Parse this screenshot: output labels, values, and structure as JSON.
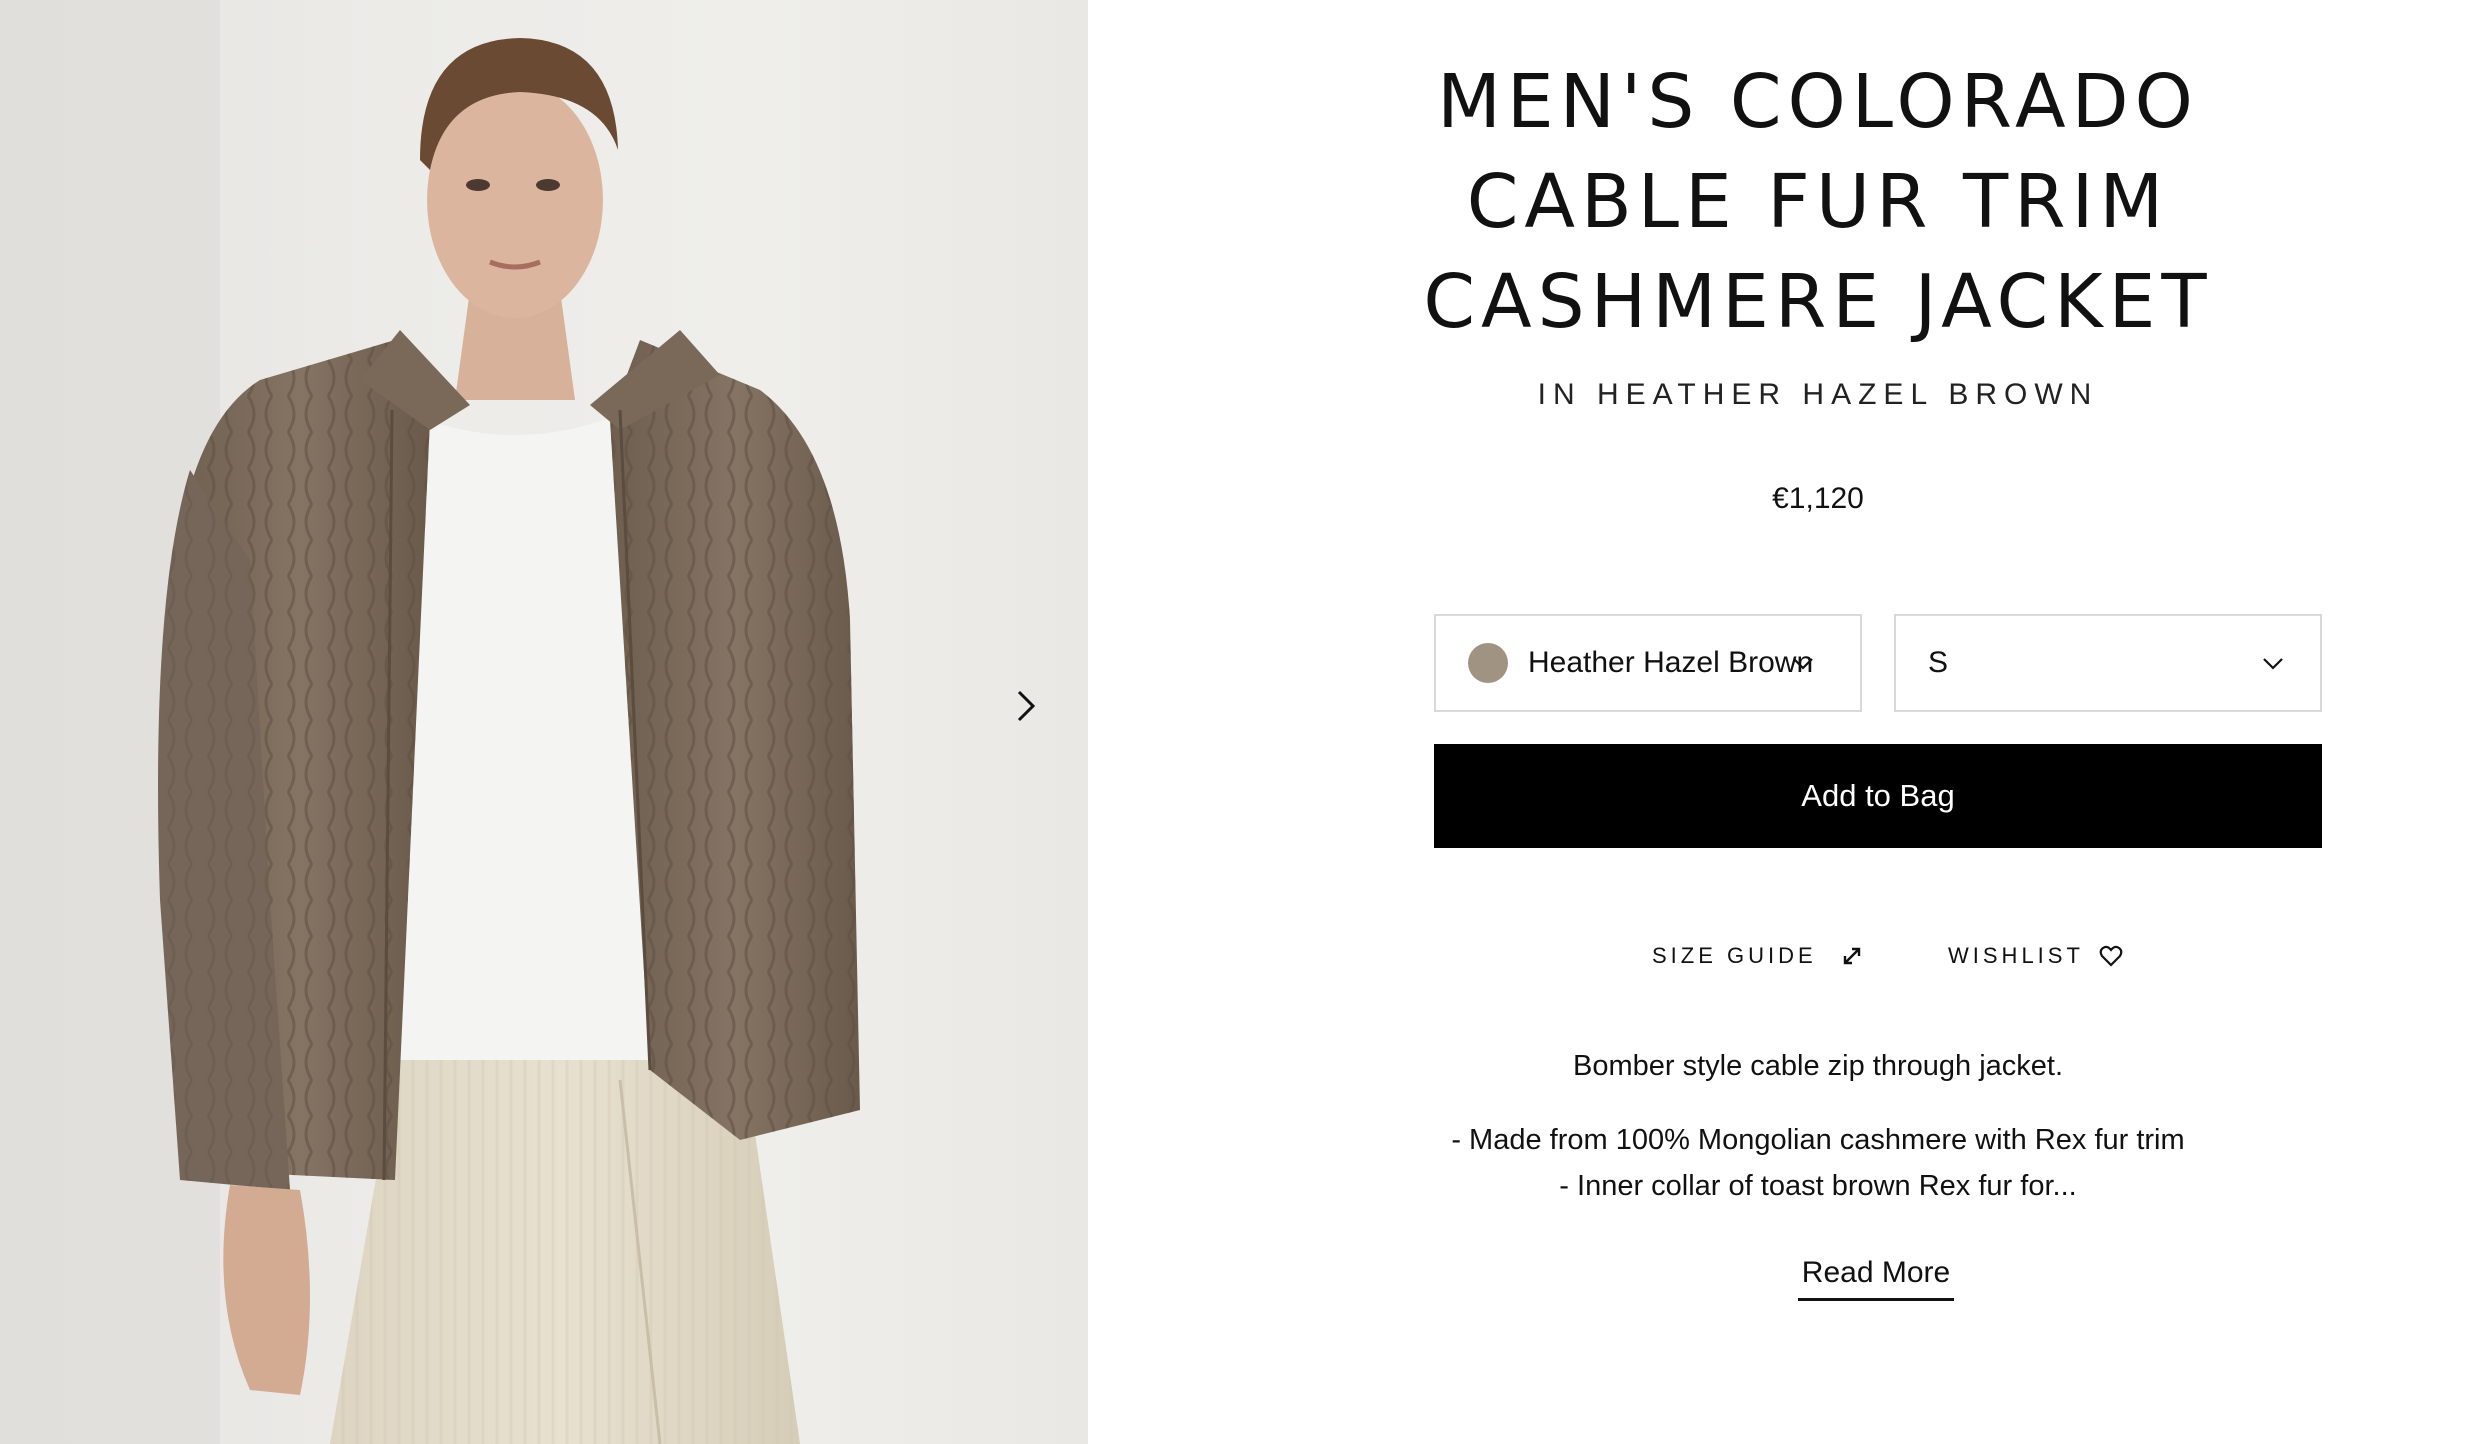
{
  "product": {
    "title_lines": [
      "MEN'S COLORADO",
      "CABLE FUR TRIM",
      "CASHMERE JACKET"
    ],
    "subtitle": "IN HEATHER HAZEL BROWN",
    "price": "€1,120"
  },
  "options": {
    "color_label": "Heather Hazel Brown",
    "color_swatch": "#a19382",
    "size_label": "S"
  },
  "actions": {
    "add_to_bag": "Add to Bag",
    "size_guide": "SIZE GUIDE",
    "wishlist": "WISHLIST",
    "read_more": "Read More"
  },
  "description": {
    "summary": "Bomber style cable zip through jacket.",
    "bullets": [
      "- Made from 100% Mongolian cashmere with Rex fur trim",
      "- Inner collar of toast brown Rex fur for..."
    ]
  },
  "icons": {
    "next": "chevron-right-icon",
    "dropdown": "chevron-down-icon",
    "size_guide": "resize-arrows-icon",
    "wishlist": "heart-icon"
  },
  "colors": {
    "button_bg": "#000000",
    "border": "#d9d9d9",
    "jacket": "#7e6d5d",
    "trousers": "#e4ddcb"
  }
}
